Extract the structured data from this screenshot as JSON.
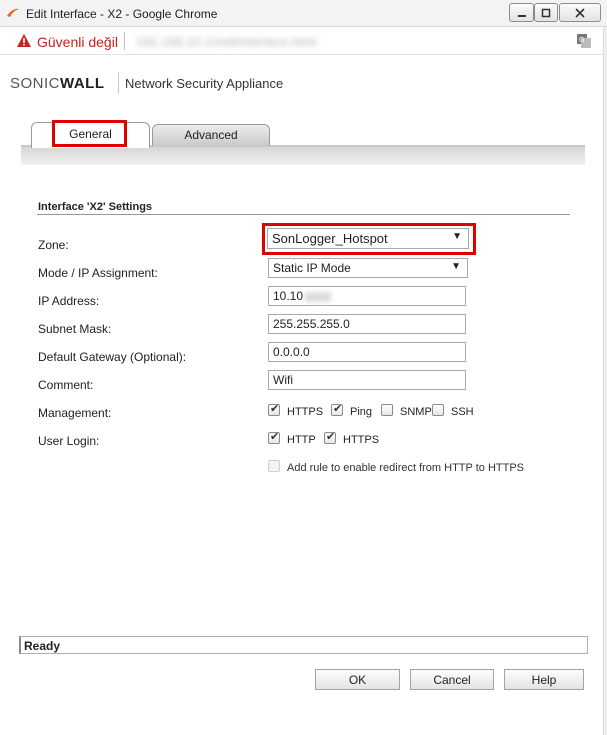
{
  "window": {
    "title": "Edit Interface - X2 - Google Chrome"
  },
  "addressbar": {
    "security_label": "Güvenli değil",
    "url": "192.168.10.1/editInterface.html"
  },
  "brand": {
    "logo_light": "SONIC",
    "logo_bold": "WALL",
    "product": "Network Security Appliance"
  },
  "tabs": [
    {
      "label": "General",
      "active": true
    },
    {
      "label": "Advanced",
      "active": false
    }
  ],
  "section": {
    "title": "Interface 'X2' Settings"
  },
  "form": {
    "zone": {
      "label": "Zone:",
      "value": "SonLogger_Hotspot"
    },
    "mode": {
      "label": "Mode / IP Assignment:",
      "value": "Static IP Mode"
    },
    "ip": {
      "label": "IP Address:",
      "value": "10.10"
    },
    "subnet": {
      "label": "Subnet Mask:",
      "value": "255.255.255.0"
    },
    "gateway": {
      "label": "Default Gateway (Optional):",
      "value": "0.0.0.0"
    },
    "comment": {
      "label": "Comment:",
      "value": "Wifi"
    },
    "management": {
      "label": "Management:",
      "options": [
        {
          "label": "HTTPS",
          "checked": true
        },
        {
          "label": "Ping",
          "checked": true
        },
        {
          "label": "SNMP",
          "checked": false
        },
        {
          "label": "SSH",
          "checked": false
        }
      ]
    },
    "user_login": {
      "label": "User Login:",
      "options": [
        {
          "label": "HTTP",
          "checked": true
        },
        {
          "label": "HTTPS",
          "checked": true
        }
      ]
    },
    "redirect": {
      "label": "Add rule to enable redirect from HTTP to HTTPS",
      "checked": false,
      "disabled": true
    }
  },
  "status": {
    "text": "Ready"
  },
  "buttons": {
    "ok": "OK",
    "cancel": "Cancel",
    "help": "Help"
  },
  "colors": {
    "highlight": "#e00000",
    "insecure": "#c5221f",
    "brand_accent": "#f26522"
  }
}
